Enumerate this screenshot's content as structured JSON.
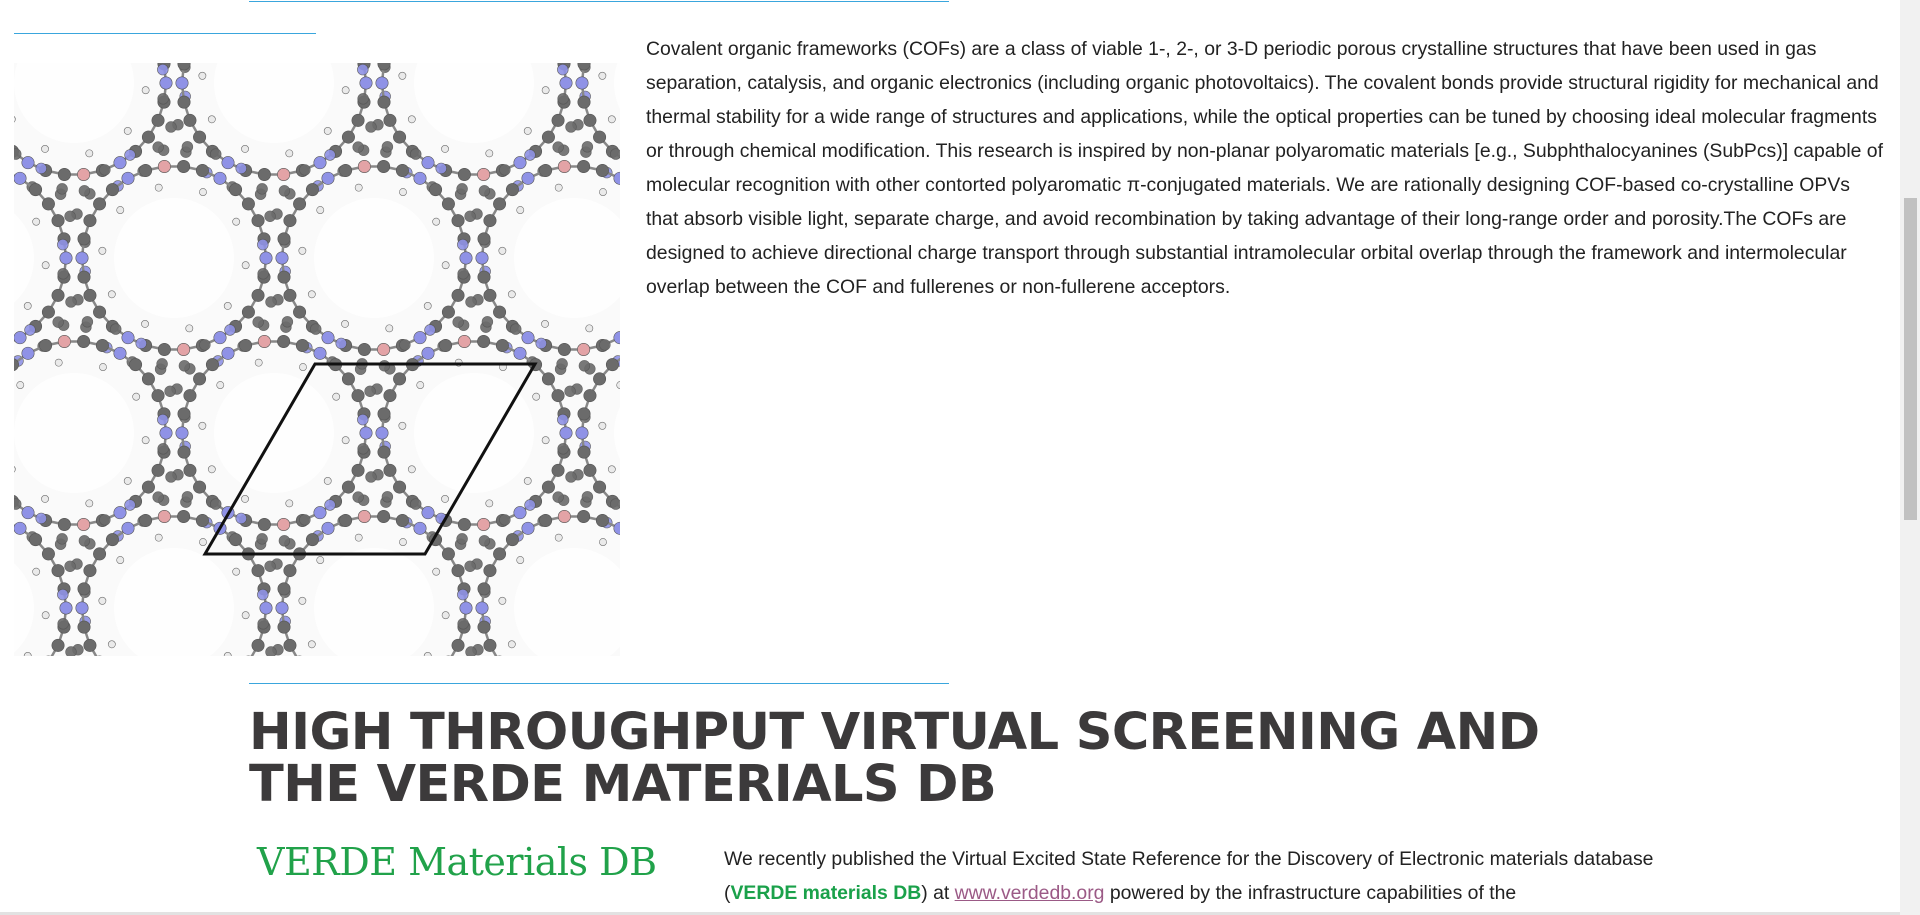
{
  "cof_section": {
    "paragraph": "Covalent organic frameworks (COFs) are a class of viable 1-, 2-, or 3-D periodic porous crystalline structures that have been used in gas separation, catalysis, and organic electronics (including organic photovoltaics). The covalent bonds provide structural rigidity for mechanical and thermal stability for a wide range of structures and applications, while the optical properties can be tuned by choosing ideal molecular fragments or through chemical modification. This research is inspired by non-planar polyaromatic materials [e.g., Subphthalocyanines (SubPcs)] capable of molecular recognition with other contorted polyaromatic π-conjugated materials. We are rationally designing COF-based co-crystalline OPVs that absorb visible light, separate charge, and avoid recombination by taking advantage of their long-range order and porosity.The COFs are designed to achieve directional charge transport through substantial intramolecular orbital overlap through the framework and intermolecular overlap between the COF and fullerenes or non-fullerene acceptors.",
    "figure_icon": "cof-molecular-structure",
    "atom_colors": {
      "carbon": "#6b6b6b",
      "nitrogen": "#8f92e6",
      "boron": "#e3a3a6",
      "hydrogen": "#e8e8e8"
    }
  },
  "verde_section": {
    "heading": "HIGH THROUGHPUT VIRTUAL SCREENING AND THE VERDE MATERIALS DB",
    "logo_text": "VERDE Materials DB",
    "text_before": "We recently published the Virtual Excited State Reference for the Discovery of Electronic materials database (",
    "bold_name": "VERDE materials DB",
    "text_mid": ") at ",
    "link_text": "www.verdedb.org",
    "text_after": " powered by the infrastructure capabilities of the"
  },
  "colors": {
    "rule": "#3aa6dd",
    "logo_green": "#21a24a",
    "link": "#9b5a86",
    "heading": "#3c3a3b"
  }
}
